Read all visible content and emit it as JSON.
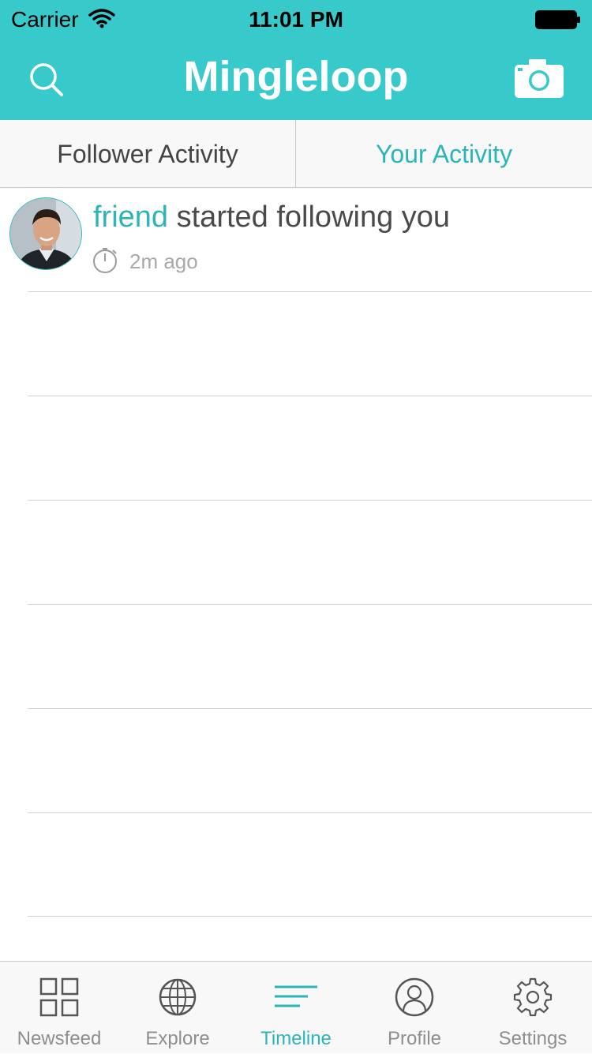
{
  "status_bar": {
    "carrier": "Carrier",
    "time": "11:01 PM"
  },
  "header": {
    "title": "Mingleloop",
    "left_icon": "search-icon",
    "right_icon": "camera-icon"
  },
  "tabs": [
    {
      "label": "Follower Activity",
      "selected": false
    },
    {
      "label": "Your Activity",
      "selected": true
    }
  ],
  "activity": [
    {
      "user": "friend",
      "action": "started following you",
      "time": "2m ago"
    }
  ],
  "tabbar": {
    "items": [
      {
        "label": "Newsfeed",
        "icon": "grid-icon",
        "active": false
      },
      {
        "label": "Explore",
        "icon": "globe-icon",
        "active": false
      },
      {
        "label": "Timeline",
        "icon": "timeline-icon",
        "active": true
      },
      {
        "label": "Profile",
        "icon": "person-icon",
        "active": false
      },
      {
        "label": "Settings",
        "icon": "gear-icon",
        "active": false
      }
    ]
  },
  "colors": {
    "accent": "#38c9cb",
    "accent_text": "#2bb5b8",
    "tabbar_bg": "#f8f8f8"
  }
}
